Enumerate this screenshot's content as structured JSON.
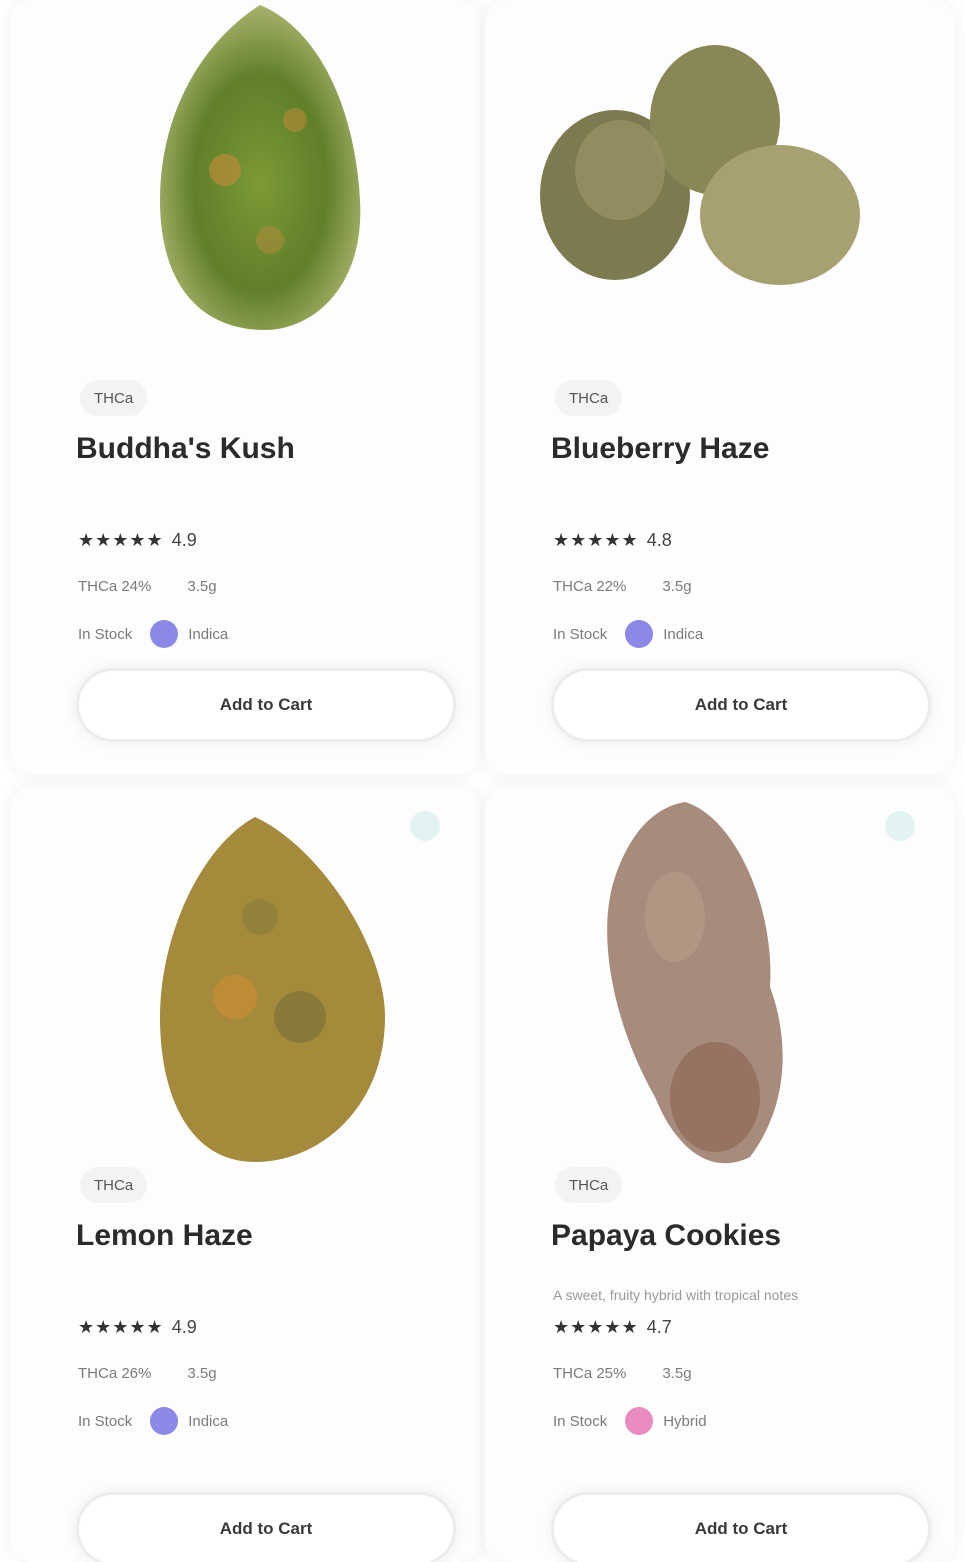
{
  "products": [
    {
      "category": "THCa",
      "name": "Buddha's Kush",
      "description": "",
      "stars": "★★★★★",
      "rating": "4.9",
      "attr1": "THCa 24%",
      "attr2": "3.5g",
      "attr3": "In Stock",
      "type": "Indica",
      "type_color": "#8b88e6",
      "button": "Add to Cart",
      "has_fav": false,
      "image": "bud-green-tall"
    },
    {
      "category": "THCa",
      "name": "Blueberry Haze",
      "description": "",
      "stars": "★★★★★",
      "rating": "4.8",
      "attr1": "THCa 22%",
      "attr2": "3.5g",
      "attr3": "In Stock",
      "type": "Indica",
      "type_color": "#8b88e6",
      "button": "Add to Cart",
      "has_fav": false,
      "image": "bud-cluster"
    },
    {
      "category": "THCa",
      "name": "Lemon Haze",
      "description": "",
      "stars": "★★★★★",
      "rating": "4.9",
      "attr1": "THCa 26%",
      "attr2": "3.5g",
      "attr3": "In Stock",
      "type": "Indica",
      "type_color": "#8b88e6",
      "button": "Add to Cart",
      "has_fav": true,
      "image": "bud-orange"
    },
    {
      "category": "THCa",
      "name": "Papaya Cookies",
      "description": "A sweet, fruity hybrid with tropical notes",
      "stars": "★★★★★",
      "rating": "4.7",
      "attr1": "THCa 25%",
      "attr2": "3.5g",
      "attr3": "In Stock",
      "type": "Hybrid",
      "type_color": "#e98bc0",
      "button": "Add to Cart",
      "has_fav": true,
      "image": "bud-purple"
    }
  ]
}
